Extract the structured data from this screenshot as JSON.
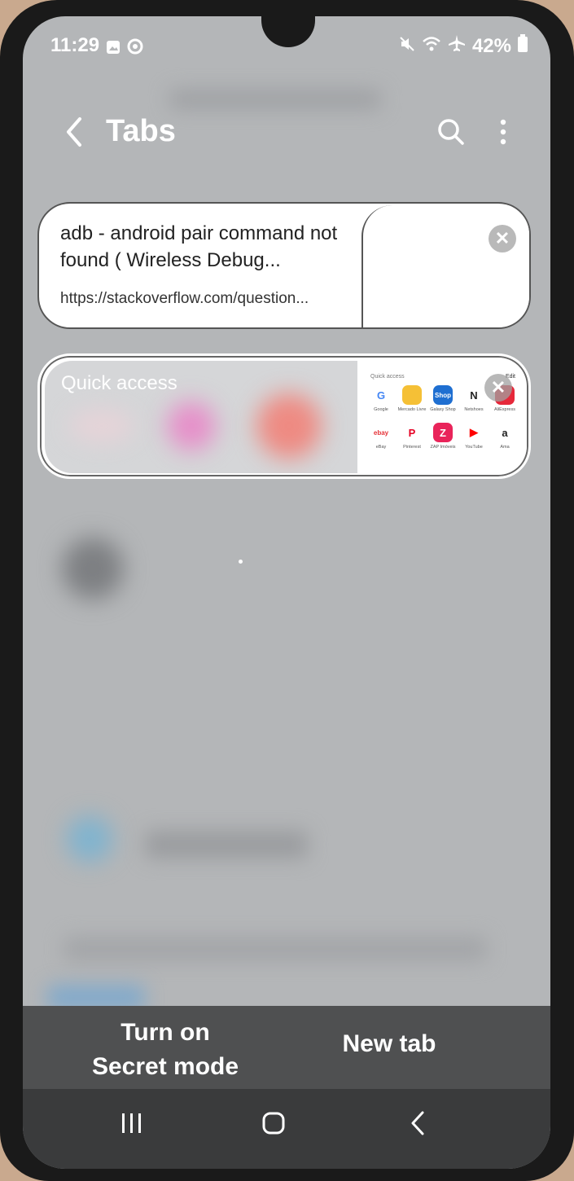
{
  "status_bar": {
    "time": "11:29",
    "battery": "42%",
    "icons": [
      "gallery-icon",
      "circle-app-icon",
      "mute-icon",
      "wifi-icon",
      "airplane-icon",
      "battery-icon"
    ]
  },
  "header": {
    "title": "Tabs",
    "back_icon": "chevron-left-icon",
    "search_icon": "search-icon",
    "more_icon": "more-vert-icon"
  },
  "tabs": [
    {
      "title": "adb - android pair command not found ( Wireless Debug...",
      "url": "https://stackoverflow.com/question..."
    },
    {
      "title": "Quick access",
      "thumbnail": {
        "heading": "Quick access",
        "edit": "Edit",
        "items": [
          {
            "label": "Google",
            "glyph": "G",
            "color": "#ffffff"
          },
          {
            "label": "Mercado Livre",
            "glyph": "",
            "color": "#f5c036"
          },
          {
            "label": "Galaxy Shop",
            "glyph": "Shop",
            "color": "#1f6fd1"
          },
          {
            "label": "Netshoes",
            "glyph": "N",
            "color": "#ffffff"
          },
          {
            "label": "AliExpress",
            "glyph": "",
            "color": "#e6283a"
          },
          {
            "label": "eBay",
            "glyph": "ebay",
            "color": "#ffffff"
          },
          {
            "label": "Pinterest",
            "glyph": "P",
            "color": "#ffffff"
          },
          {
            "label": "ZAP Imóveis",
            "glyph": "Z",
            "color": "#e9245a"
          },
          {
            "label": "YouTube",
            "glyph": "▶",
            "color": "#ffffff"
          },
          {
            "label": "Ama",
            "glyph": "a",
            "color": "#ffffff"
          }
        ]
      }
    }
  ],
  "bottom_actions": {
    "secret_line1": "Turn on",
    "secret_line2": "Secret mode",
    "new_tab": "New tab"
  },
  "nav": {
    "recents": "recents-icon",
    "home": "home-icon",
    "back": "back-icon"
  }
}
